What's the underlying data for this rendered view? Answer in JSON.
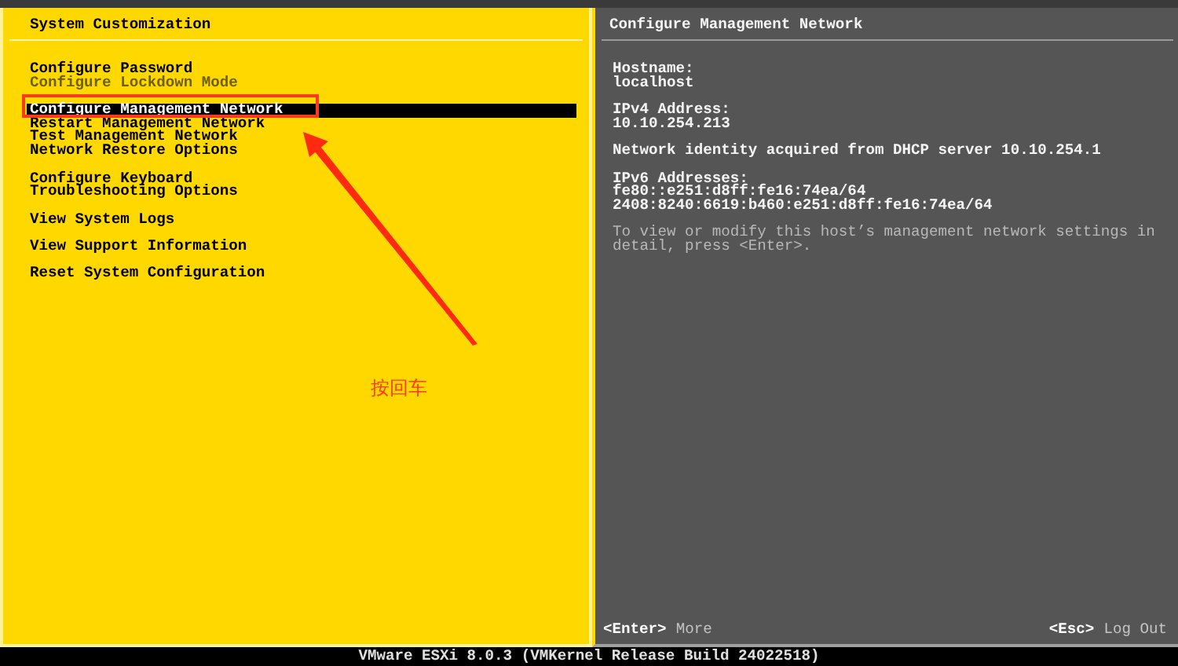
{
  "menu": {
    "title": "System Customization",
    "groups": [
      [
        {
          "label": "Configure Password",
          "selected": false,
          "disabled": false
        },
        {
          "label": "Configure Lockdown Mode",
          "selected": false,
          "disabled": true
        }
      ],
      [
        {
          "label": "Configure Management Network",
          "selected": true,
          "disabled": false
        },
        {
          "label": "Restart Management Network",
          "selected": false,
          "disabled": false
        },
        {
          "label": "Test Management Network",
          "selected": false,
          "disabled": false
        },
        {
          "label": "Network Restore Options",
          "selected": false,
          "disabled": false
        }
      ],
      [
        {
          "label": "Configure Keyboard",
          "selected": false,
          "disabled": false
        },
        {
          "label": "Troubleshooting Options",
          "selected": false,
          "disabled": false
        }
      ],
      [
        {
          "label": "View System Logs",
          "selected": false,
          "disabled": false
        }
      ],
      [
        {
          "label": "View Support Information",
          "selected": false,
          "disabled": false
        }
      ],
      [
        {
          "label": "Reset System Configuration",
          "selected": false,
          "disabled": false
        }
      ]
    ]
  },
  "annotation": {
    "text": "按回车"
  },
  "details": {
    "title": "Configure Management Network",
    "blocks": [
      {
        "kind": "field",
        "lines": [
          "Hostname:",
          "localhost"
        ]
      },
      {
        "kind": "field",
        "lines": [
          "IPv4 Address:",
          "10.10.254.213"
        ]
      },
      {
        "kind": "field",
        "lines": [
          "Network identity acquired from DHCP server 10.10.254.1"
        ]
      },
      {
        "kind": "field",
        "lines": [
          "IPv6 Addresses:",
          "fe80::e251:d8ff:fe16:74ea/64",
          "2408:8240:6619:b460:e251:d8ff:fe16:74ea/64"
        ]
      },
      {
        "kind": "note",
        "lines": [
          "To view or modify this host’s management network settings in detail, press <Enter>."
        ]
      }
    ],
    "footer": [
      {
        "key": "<Enter>",
        "action": "More"
      },
      {
        "key": "<Esc>",
        "action": "Log Out"
      }
    ]
  },
  "status_bar": "VMware ESXi 8.0.3 (VMKernel Release Build 24022518)"
}
